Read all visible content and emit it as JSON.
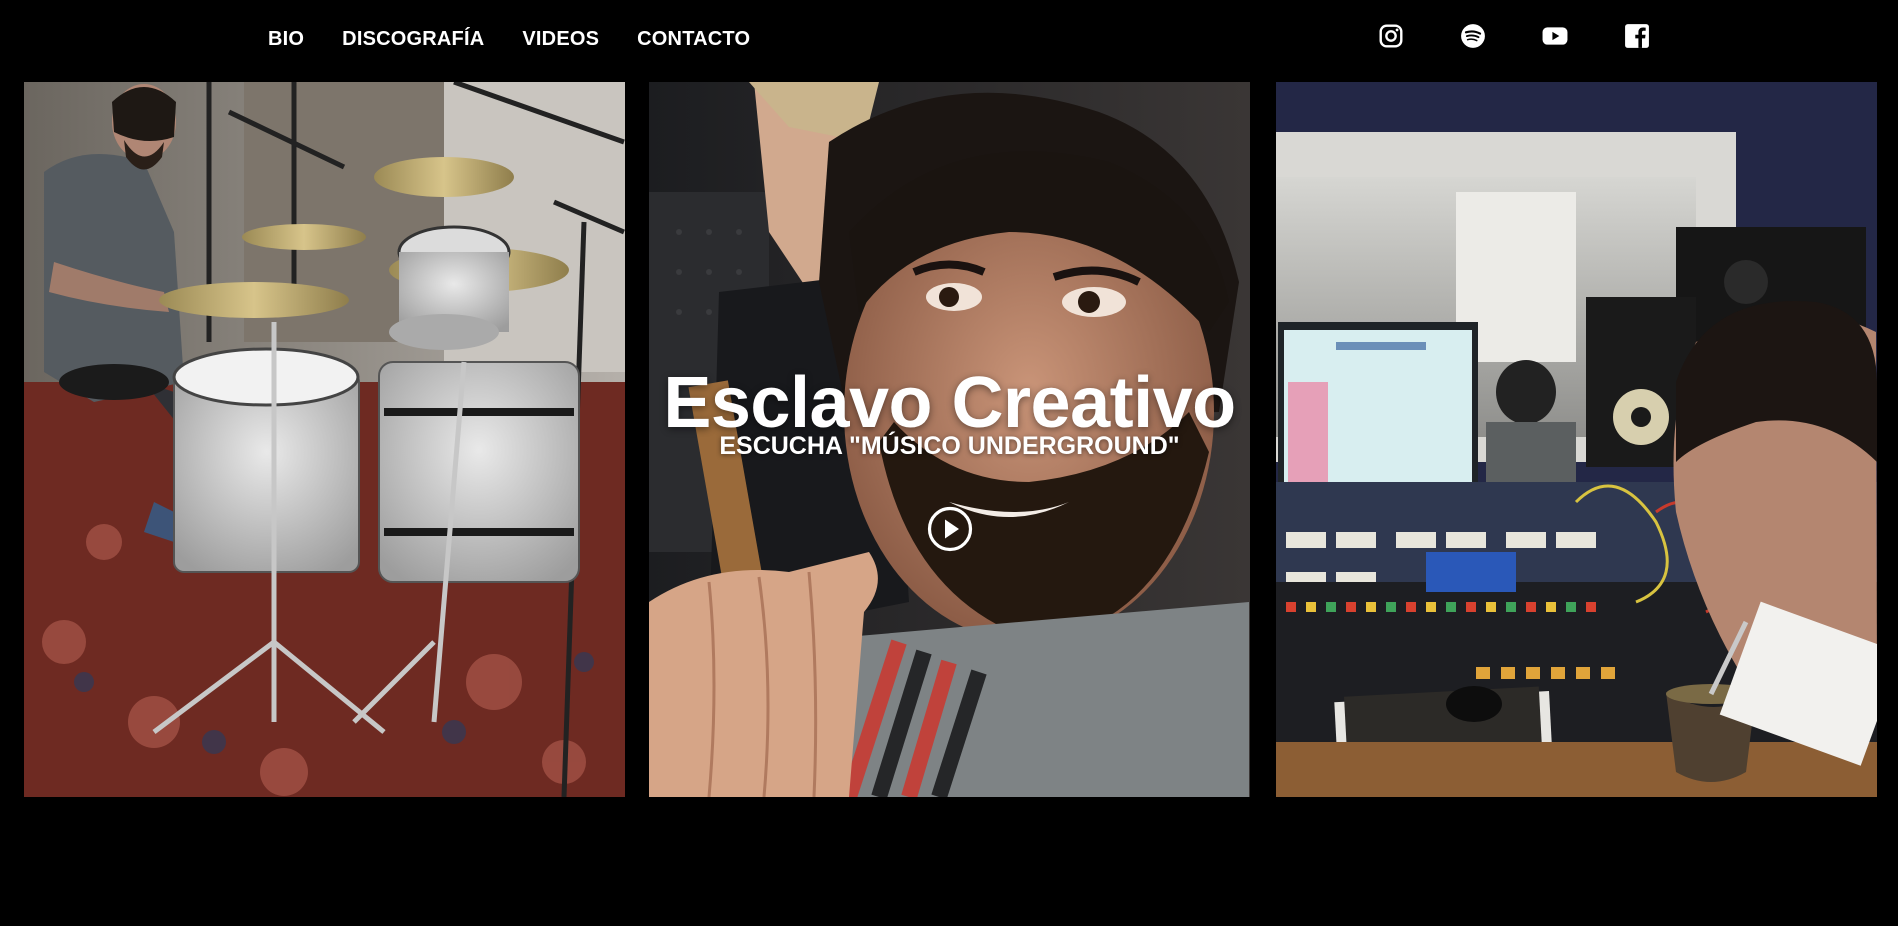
{
  "nav": {
    "items": [
      {
        "label": "BIO"
      },
      {
        "label": "DISCOGRAFÍA"
      },
      {
        "label": "VIDEOS"
      },
      {
        "label": "CONTACTO"
      }
    ]
  },
  "social": {
    "icons": [
      "instagram-icon",
      "spotify-icon",
      "youtube-icon",
      "facebook-icon"
    ]
  },
  "hero": {
    "title": "Esclavo Creativo",
    "subtitle": "ESCUCHA \"MÚSICO UNDERGROUND\"",
    "play_icon": "play-icon"
  },
  "colors": {
    "background": "#000000",
    "text": "#ffffff"
  }
}
